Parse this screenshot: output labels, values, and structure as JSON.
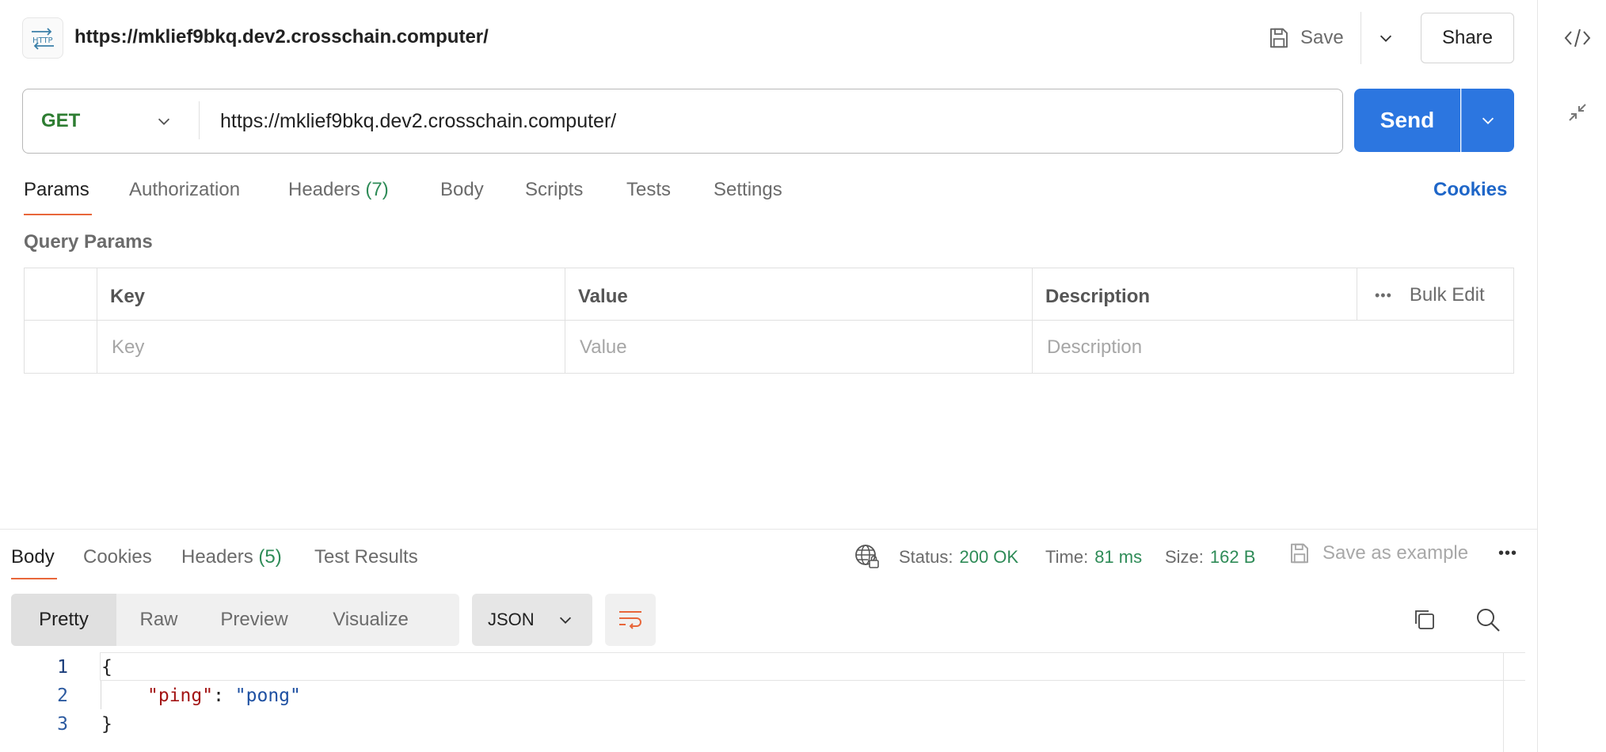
{
  "header": {
    "request_title": "https://mklief9bkq.dev2.crosschain.computer/",
    "save_label": "Save",
    "share_label": "Share"
  },
  "request": {
    "method": "GET",
    "url": "https://mklief9bkq.dev2.crosschain.computer/",
    "send_label": "Send"
  },
  "request_tabs": [
    {
      "label": "Params",
      "active": true
    },
    {
      "label": "Authorization"
    },
    {
      "label": "Headers",
      "count": "(7)"
    },
    {
      "label": "Body"
    },
    {
      "label": "Scripts"
    },
    {
      "label": "Tests"
    },
    {
      "label": "Settings"
    }
  ],
  "cookies_link": "Cookies",
  "query_params": {
    "title": "Query Params",
    "columns": [
      "Key",
      "Value",
      "Description"
    ],
    "bulk_edit": "Bulk Edit",
    "placeholders": {
      "key": "Key",
      "value": "Value",
      "description": "Description"
    }
  },
  "response": {
    "tabs": [
      {
        "label": "Body",
        "active": true
      },
      {
        "label": "Cookies"
      },
      {
        "label": "Headers",
        "count": "(5)"
      },
      {
        "label": "Test Results"
      }
    ],
    "status_label": "Status:",
    "status_value": "200 OK",
    "time_label": "Time:",
    "time_value": "81 ms",
    "size_label": "Size:",
    "size_value": "162 B",
    "save_example": "Save as example",
    "views": [
      "Pretty",
      "Raw",
      "Preview",
      "Visualize"
    ],
    "format": "JSON",
    "code_lines": [
      {
        "num": "1",
        "text": "{"
      },
      {
        "num": "2",
        "key": "\"ping\"",
        "sep": ": ",
        "value": "\"pong\""
      },
      {
        "num": "3",
        "text": "}"
      }
    ]
  },
  "colors": {
    "send": "#2c76e0",
    "method": "#2e7d32",
    "tab_underline": "#e8663a",
    "status_green": "#2e8b57",
    "link_blue": "#1e66c8"
  }
}
